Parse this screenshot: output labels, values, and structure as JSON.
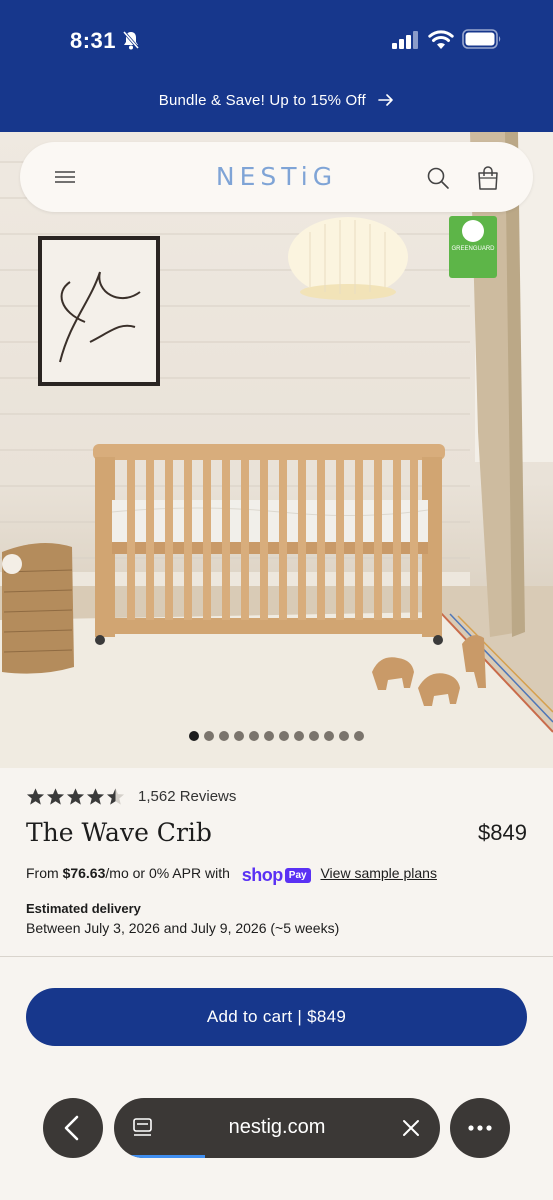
{
  "status_bar": {
    "time": "8:31"
  },
  "promo": {
    "text": "Bundle & Save! Up to 15% Off"
  },
  "nav": {
    "logo": "NESTiG"
  },
  "badge": {
    "label": "GREENGUARD"
  },
  "carousel": {
    "slide_count": 12,
    "active_index": 0
  },
  "product": {
    "rating": 4.5,
    "reviews_label": "1,562 Reviews",
    "title": "The Wave Crib",
    "price": "$849",
    "finance_prefix": "From ",
    "finance_amount": "$76.63",
    "finance_suffix": "/mo or 0% APR with",
    "shop_word": "shop",
    "pay_word": "Pay",
    "plans_link": "View sample plans",
    "delivery_heading": "Estimated delivery",
    "delivery_text": "Between July 3, 2026 and July 9, 2026 (~5 weeks)",
    "add_to_cart": "Add to cart | $849"
  },
  "browser": {
    "url": "nestig.com",
    "load_progress": 0.25
  },
  "colors": {
    "brand_blue": "#17378c",
    "logo_blue": "#7fa4d6",
    "shop_pay_purple": "#5a31f4",
    "greenguard_green": "#5db548"
  },
  "icons": [
    "bell-slash-icon",
    "cellular-signal-icon",
    "wifi-icon",
    "battery-icon",
    "arrow-right-icon",
    "hamburger-menu-icon",
    "search-icon",
    "shopping-bag-icon",
    "star-icon",
    "chevron-left-icon",
    "tabs-icon",
    "close-icon",
    "more-icon"
  ]
}
